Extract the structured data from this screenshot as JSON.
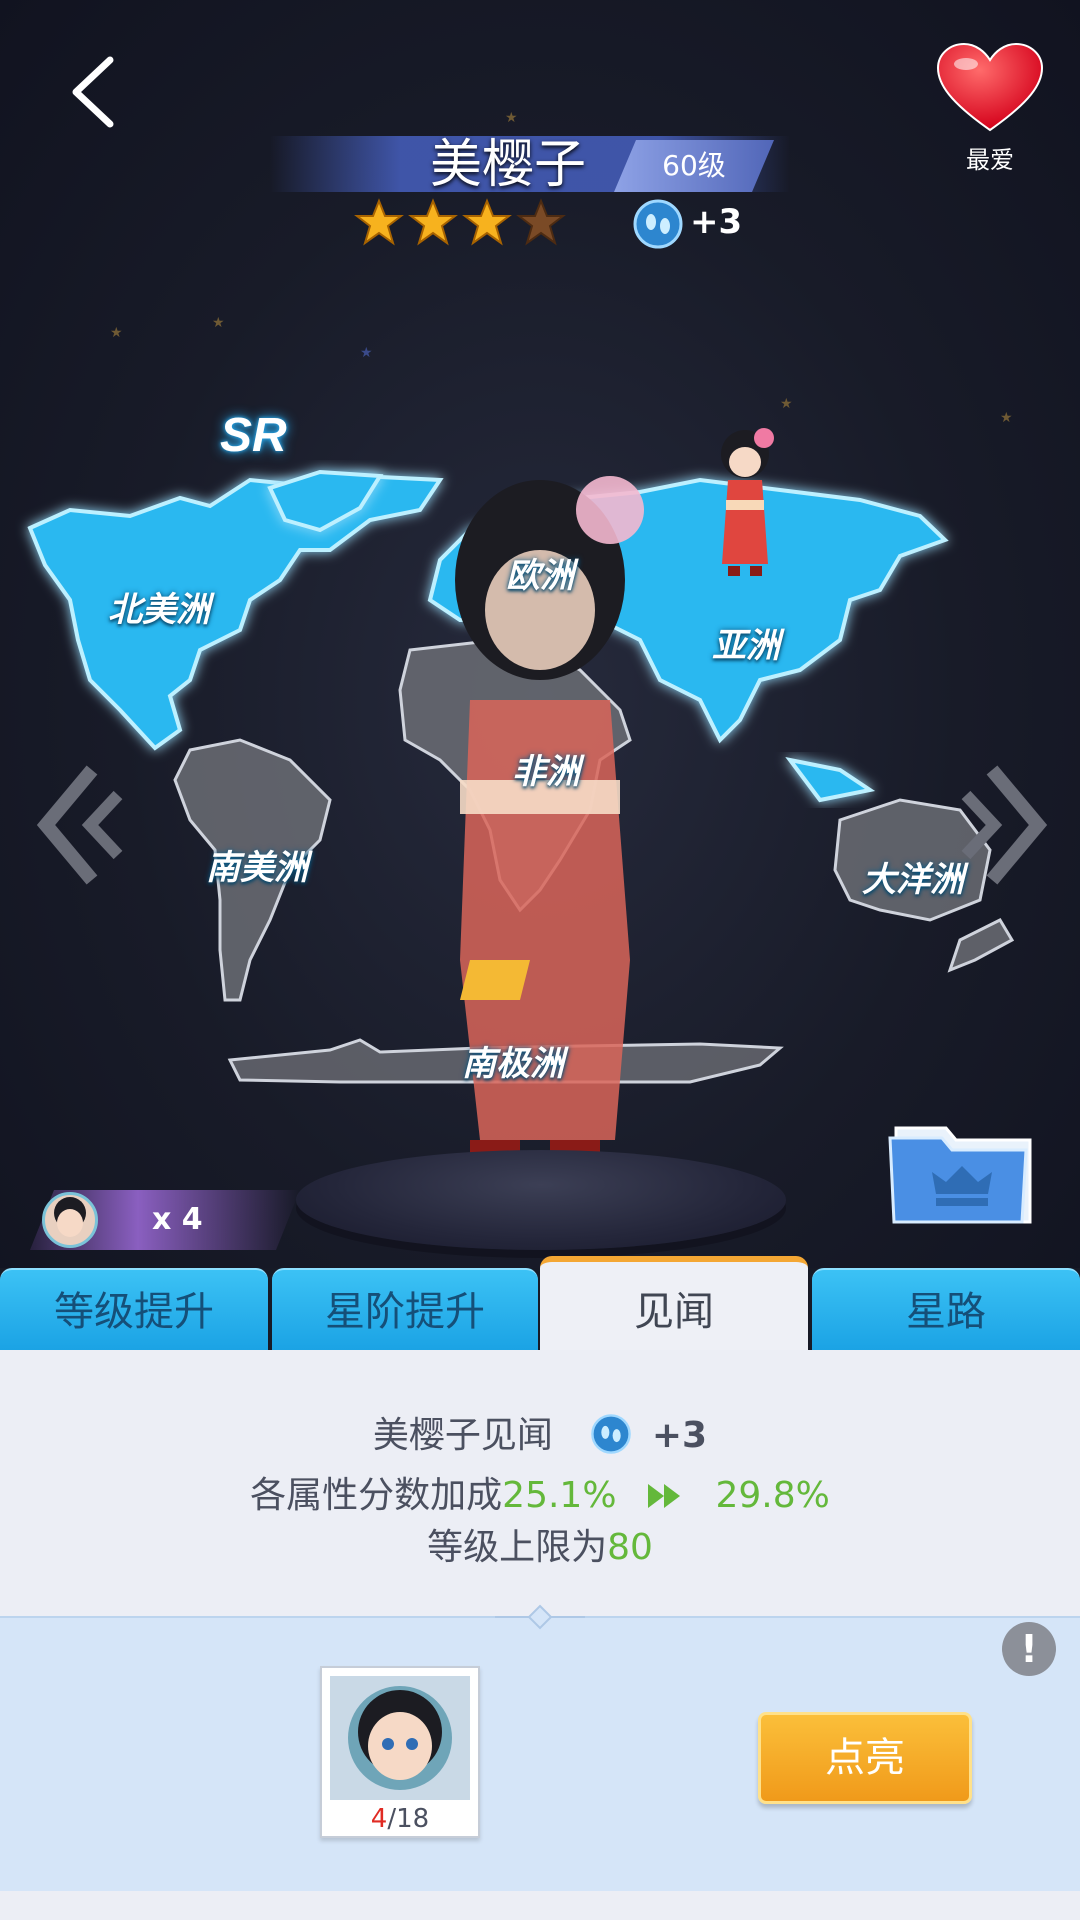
{
  "header": {
    "back_icon": "back-chevron-icon",
    "character_name": "美樱子",
    "level": "60级",
    "stars_filled": 3,
    "stars_total": 4,
    "gem_bonus": "+3",
    "favorite_label": "最爱",
    "favorite_icon": "heart-icon"
  },
  "map": {
    "rarity": "SR",
    "continents": [
      "北美洲",
      "欧洲",
      "亚洲",
      "非洲",
      "南美洲",
      "大洋洲",
      "南极洲"
    ],
    "colors": {
      "lit": "#2bb8f0",
      "unlit": "#6b6d74"
    }
  },
  "shards": {
    "count": "x 4"
  },
  "tabs": [
    "等级提升",
    "星阶提升",
    "见闻",
    "星路"
  ],
  "active_tab": "见闻",
  "insight": {
    "title": "美樱子见闻",
    "gem_bonus": "+3",
    "bonus_label": "各属性分数加成",
    "bonus_current": "25.1%",
    "bonus_next": "29.8%",
    "level_cap_label": "等级上限为",
    "level_cap_value": "80"
  },
  "card": {
    "current": "4",
    "total": "/18"
  },
  "light_button": "点亮",
  "info_button": "!"
}
